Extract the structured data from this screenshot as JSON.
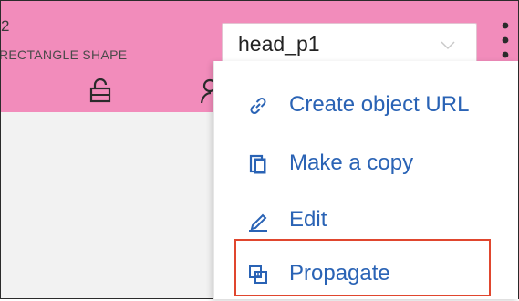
{
  "object": {
    "number": "2",
    "type_label": "RECTANGLE SHAPE"
  },
  "selector": {
    "value": "head_p1"
  },
  "icons": {
    "lock": "lock-icon",
    "person": "person-icon",
    "kebab": "more-vertical-icon",
    "chevron": "chevron-down-icon"
  },
  "menu": {
    "items": [
      {
        "label": "Create object URL",
        "icon": "link-icon"
      },
      {
        "label": "Make a copy",
        "icon": "copy-icon"
      },
      {
        "label": "Edit",
        "icon": "pencil-icon"
      },
      {
        "label": "Propagate",
        "icon": "propagate-icon"
      }
    ]
  },
  "colors": {
    "header": "#f28cbb",
    "menu_text": "#2a63b5",
    "highlight": "#e0462e"
  }
}
